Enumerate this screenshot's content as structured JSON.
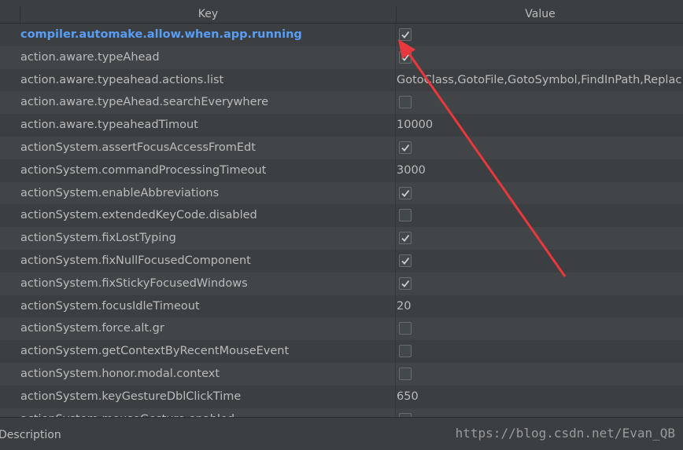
{
  "columns": {
    "key": "Key",
    "value": "Value"
  },
  "rows": [
    {
      "key": "compiler.automake.allow.when.app.running",
      "type": "checkbox",
      "checked": true,
      "modified": true
    },
    {
      "key": "action.aware.typeAhead",
      "type": "checkbox",
      "checked": true
    },
    {
      "key": "action.aware.typeahead.actions.list",
      "type": "text",
      "value": "GotoClass,GotoFile,GotoSymbol,FindInPath,Replac"
    },
    {
      "key": "action.aware.typeAhead.searchEverywhere",
      "type": "checkbox",
      "checked": false
    },
    {
      "key": "action.aware.typeaheadTimout",
      "type": "text",
      "value": "10000"
    },
    {
      "key": "actionSystem.assertFocusAccessFromEdt",
      "type": "checkbox",
      "checked": true
    },
    {
      "key": "actionSystem.commandProcessingTimeout",
      "type": "text",
      "value": "3000"
    },
    {
      "key": "actionSystem.enableAbbreviations",
      "type": "checkbox",
      "checked": true
    },
    {
      "key": "actionSystem.extendedKeyCode.disabled",
      "type": "checkbox",
      "checked": false
    },
    {
      "key": "actionSystem.fixLostTyping",
      "type": "checkbox",
      "checked": true
    },
    {
      "key": "actionSystem.fixNullFocusedComponent",
      "type": "checkbox",
      "checked": true
    },
    {
      "key": "actionSystem.fixStickyFocusedWindows",
      "type": "checkbox",
      "checked": true
    },
    {
      "key": "actionSystem.focusIdleTimeout",
      "type": "text",
      "value": "20"
    },
    {
      "key": "actionSystem.force.alt.gr",
      "type": "checkbox",
      "checked": false
    },
    {
      "key": "actionSystem.getContextByRecentMouseEvent",
      "type": "checkbox",
      "checked": false
    },
    {
      "key": "actionSystem.honor.modal.context",
      "type": "checkbox",
      "checked": false
    },
    {
      "key": "actionSystem.keyGestureDblClickTime",
      "type": "text",
      "value": "650"
    },
    {
      "key": "actionSystem.mouseGesture.enabled",
      "type": "checkbox",
      "checked": false
    }
  ],
  "footer": {
    "description_label": "Description",
    "watermark": "https://blog.csdn.net/Evan_QB"
  },
  "colors": {
    "modified_key": "#589df6",
    "annotation_arrow": "#e8383d"
  },
  "icons": {
    "check": "check-icon"
  }
}
